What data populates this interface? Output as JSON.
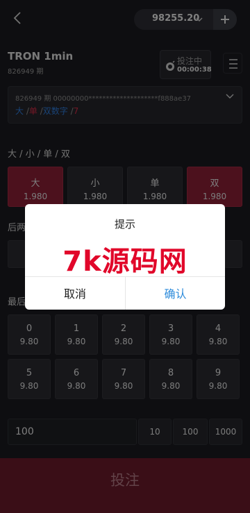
{
  "header": {
    "balance": "98255.20",
    "back_icon": "chevron-left-icon",
    "plus_icon": "plus-icon"
  },
  "game": {
    "title": "TRON 1min",
    "issue": "826949 期",
    "status_label": "投注中",
    "countdown": "00:00:38"
  },
  "last_result": {
    "line1": "826949 期    00000000********************f888ae37",
    "tags": [
      {
        "text": "大",
        "color": "#2f7ad9"
      },
      {
        "text": " /",
        "color": "#8c8c8c"
      },
      {
        "text": "单",
        "color": "#d32b45"
      },
      {
        "text": " /",
        "color": "#8c8c8c"
      },
      {
        "text": "双数字",
        "color": "#2f7ad9"
      },
      {
        "text": " /",
        "color": "#8c8c8c"
      },
      {
        "text": "7",
        "color": "#d32b45"
      }
    ]
  },
  "sections": {
    "big_small": "大 / 小 / 单 / 双",
    "last_two": "后两",
    "last_digit": "最后"
  },
  "bet_options": [
    {
      "name": "大",
      "odds": "1.980",
      "selected": true
    },
    {
      "name": "小",
      "odds": "1.980",
      "selected": false
    },
    {
      "name": "单",
      "odds": "1.980",
      "selected": false
    },
    {
      "name": "双",
      "odds": "1.980",
      "selected": true
    }
  ],
  "digits": [
    {
      "name": "0",
      "odds": "9.80"
    },
    {
      "name": "1",
      "odds": "9.80"
    },
    {
      "name": "2",
      "odds": "9.80"
    },
    {
      "name": "3",
      "odds": "9.80"
    },
    {
      "name": "4",
      "odds": "9.80"
    },
    {
      "name": "5",
      "odds": "9.80"
    },
    {
      "name": "6",
      "odds": "9.80"
    },
    {
      "name": "7",
      "odds": "9.80"
    },
    {
      "name": "8",
      "odds": "9.80"
    },
    {
      "name": "9",
      "odds": "9.80"
    }
  ],
  "amount": {
    "value": "100",
    "quick": [
      "10",
      "100",
      "1000"
    ]
  },
  "submit_label": "投注",
  "dialog": {
    "title": "提示",
    "watermark": "7k源码网",
    "cancel": "取消",
    "confirm": "确认"
  }
}
